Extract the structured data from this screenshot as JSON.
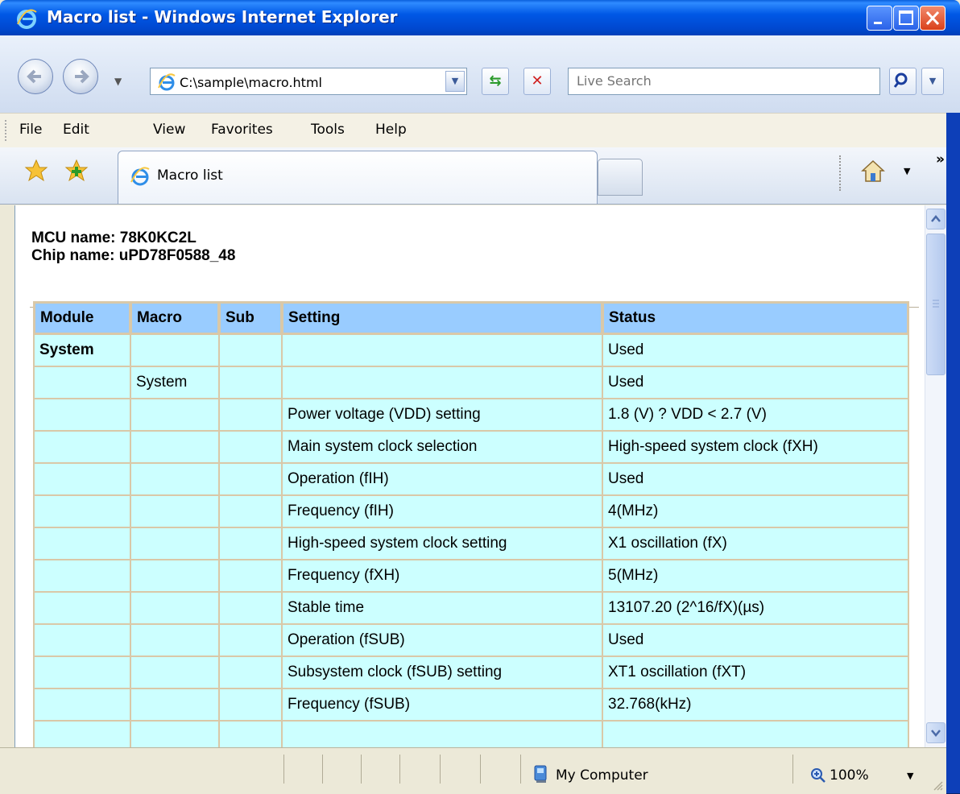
{
  "window": {
    "title": "Macro list - Windows Internet Explorer"
  },
  "address": {
    "url": "C:\\sample\\macro.html"
  },
  "search": {
    "placeholder": "Live Search"
  },
  "menu": {
    "items": [
      "File",
      "Edit",
      "View",
      "Favorites",
      "Tools",
      "Help"
    ]
  },
  "tab": {
    "title": "Macro list"
  },
  "page": {
    "mcu": "MCU name: 78K0KC2L",
    "chip": "Chip name: uPD78F0588_48"
  },
  "table": {
    "headers": [
      "Module",
      "Macro",
      "Sub",
      "Setting",
      "Status"
    ],
    "rows": [
      [
        "System",
        "",
        "",
        "",
        "Used"
      ],
      [
        "",
        "System",
        "",
        "",
        "Used"
      ],
      [
        "",
        "",
        "",
        "Power voltage (VDD) setting",
        "1.8 (V) ? VDD < 2.7 (V)"
      ],
      [
        "",
        "",
        "",
        "Main system clock selection",
        "High-speed system clock (fXH)"
      ],
      [
        "",
        "",
        "",
        "Operation (fIH)",
        "Used"
      ],
      [
        "",
        "",
        "",
        "Frequency (fIH)",
        "4(MHz)"
      ],
      [
        "",
        "",
        "",
        "High-speed system clock setting",
        "X1 oscillation (fX)"
      ],
      [
        "",
        "",
        "",
        "Frequency (fXH)",
        "5(MHz)"
      ],
      [
        "",
        "",
        "",
        "Stable time",
        "13107.20 (2^16/fX)(µs)"
      ],
      [
        "",
        "",
        "",
        "Operation (fSUB)",
        "Used"
      ],
      [
        "",
        "",
        "",
        "Subsystem clock (fSUB) setting",
        "XT1 oscillation (fXT)"
      ],
      [
        "",
        "",
        "",
        "Frequency (fSUB)",
        "32.768(kHz)"
      ],
      [
        "",
        "",
        "",
        "",
        ""
      ]
    ]
  },
  "statusbar": {
    "zone": "My Computer",
    "zoom": "100%"
  }
}
